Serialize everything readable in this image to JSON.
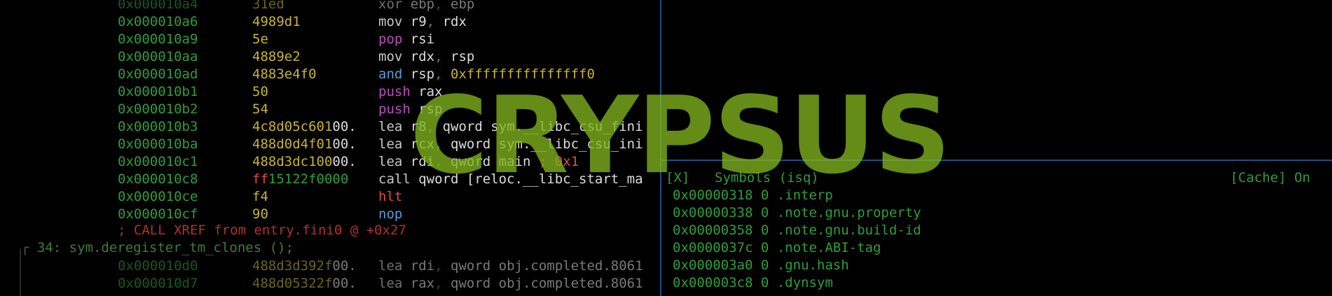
{
  "disasm": [
    {
      "addr": "0x000010a4",
      "bytes": "31ed",
      "op": "xor",
      "args": [
        {
          "t": "ebp",
          "c": "c-white"
        },
        {
          "t": ", ",
          "c": "c-green"
        },
        {
          "t": "ebp",
          "c": "c-white"
        }
      ],
      "opc": "op-grey"
    },
    {
      "addr": "0x000010a6",
      "bytes": "4989d1",
      "op": "mov",
      "args": [
        {
          "t": "r9",
          "c": "c-white"
        },
        {
          "t": ", ",
          "c": "c-green"
        },
        {
          "t": "rdx",
          "c": "c-white"
        }
      ],
      "opc": "op-grey"
    },
    {
      "addr": "0x000010a9",
      "bytes": "5e",
      "op": "pop",
      "args": [
        {
          "t": "rsi",
          "c": "c-white"
        }
      ],
      "opc": "op-purple"
    },
    {
      "addr": "0x000010aa",
      "bytes": "4889e2",
      "op": "mov",
      "args": [
        {
          "t": "rdx",
          "c": "c-white"
        },
        {
          "t": ", ",
          "c": "c-green"
        },
        {
          "t": "rsp",
          "c": "c-white"
        }
      ],
      "opc": "op-grey"
    },
    {
      "addr": "0x000010ad",
      "bytes": "4883e4f0",
      "op": "and",
      "args": [
        {
          "t": "rsp",
          "c": "c-white"
        },
        {
          "t": ", ",
          "c": "c-green"
        },
        {
          "t": "0xfffffffffffffff0",
          "c": "c-yellow"
        }
      ],
      "opc": "op-blue"
    },
    {
      "addr": "0x000010b1",
      "bytes": "50",
      "op": "push",
      "args": [
        {
          "t": "rax",
          "c": "c-white"
        }
      ],
      "opc": "op-purple"
    },
    {
      "addr": "0x000010b2",
      "bytes": "54",
      "op": "push",
      "args": [
        {
          "t": "rsp",
          "c": "c-white"
        }
      ],
      "opc": "op-purple"
    },
    {
      "addr": "0x000010b3",
      "bytes": "4c8d05c60100.",
      "op": "lea",
      "args": [
        {
          "t": "r8",
          "c": "c-white"
        },
        {
          "t": ", ",
          "c": "c-green"
        },
        {
          "t": "qword",
          "c": "c-white"
        },
        {
          "t": " sym.__libc_csu_fini",
          "c": "c-white"
        }
      ],
      "opc": "op-grey"
    },
    {
      "addr": "0x000010ba",
      "bytes": "488d0d4f0100.",
      "op": "lea",
      "args": [
        {
          "t": "rcx",
          "c": "c-white"
        },
        {
          "t": ", ",
          "c": "c-green"
        },
        {
          "t": "qword",
          "c": "c-white"
        },
        {
          "t": " sym.__libc_csu_ini",
          "c": "c-white"
        }
      ],
      "opc": "op-grey"
    },
    {
      "addr": "0x000010c1",
      "bytes": "488d3dc10000.",
      "op": "lea",
      "args": [
        {
          "t": "rdi",
          "c": "c-white"
        },
        {
          "t": ", ",
          "c": "c-green"
        },
        {
          "t": "qword",
          "c": "c-white"
        },
        {
          "t": " main",
          "c": "c-white"
        },
        {
          "t": "            ; 0x1",
          "c": "c-red"
        }
      ],
      "opc": "op-grey"
    },
    {
      "addr": "0x000010c8",
      "bytes": "ff15122f0000",
      "op": "call",
      "args": [
        {
          "t": "qword",
          "c": "c-white"
        },
        {
          "t": " [reloc.__libc_start_ma",
          "c": "c-white"
        }
      ],
      "opc": "op-grey"
    },
    {
      "addr": "0x000010ce",
      "bytes": "f4",
      "op": "hlt",
      "args": [],
      "opc": "op-red"
    },
    {
      "addr": "0x000010cf",
      "bytes": "90",
      "op": "nop",
      "args": [],
      "opc": "op-blue"
    }
  ],
  "xref": "; CALL XREF from entry.fini0 @ +0x27",
  "func": {
    "corner": "┌",
    "label": " 34: sym.deregister_tm_clones ();"
  },
  "disasm2": [
    {
      "addr": "0x000010d0",
      "bytes": "488d3d392f00.",
      "op": "lea",
      "args": [
        {
          "t": "rdi",
          "c": "c-white"
        },
        {
          "t": ", ",
          "c": "c-green"
        },
        {
          "t": "qword",
          "c": "c-white"
        },
        {
          "t": " obj.completed.8061",
          "c": "c-white"
        }
      ],
      "opc": "op-grey"
    },
    {
      "addr": "0x000010d7",
      "bytes": "488d05322f00.",
      "op": "lea",
      "args": [
        {
          "t": "rax",
          "c": "c-white"
        },
        {
          "t": ", ",
          "c": "c-green"
        },
        {
          "t": "qword",
          "c": "c-white"
        },
        {
          "t": " obj.completed.8061",
          "c": "c-white"
        }
      ],
      "opc": "op-grey"
    }
  ],
  "symbols_panel": {
    "close": "[X]",
    "title": "Symbols (isq)",
    "cache": "[Cache] On",
    "rows": [
      "0x00000318 0 .interp",
      "0x00000338 0 .note.gnu.property",
      "0x00000358 0 .note.gnu.build-id",
      "0x0000037c 0 .note.ABI-tag",
      "0x000003a0 0 .gnu.hash",
      "0x000003c8 0 .dynsym"
    ]
  },
  "watermark": "CRYPSUS"
}
